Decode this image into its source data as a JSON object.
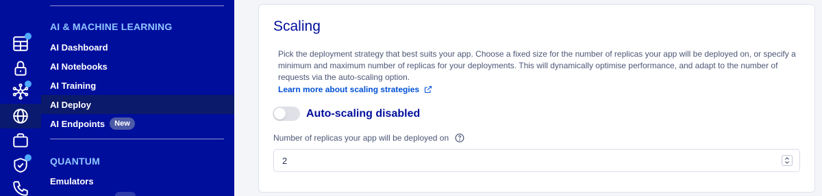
{
  "rail": {
    "icons": [
      "server-icon",
      "lock-icon",
      "network-icon",
      "globe-icon",
      "briefcase-icon",
      "shield-check-icon",
      "phone-icon"
    ],
    "accent": "#000e9c",
    "dot_color": "#4fa8ff"
  },
  "sidebar": {
    "ai_section": {
      "title": "AI & MACHINE LEARNING",
      "items": [
        {
          "label": "AI Dashboard"
        },
        {
          "label": "AI Notebooks"
        },
        {
          "label": "AI Training"
        },
        {
          "label": "AI Deploy"
        },
        {
          "label": "AI Endpoints",
          "badge": "New"
        }
      ]
    },
    "quantum_section": {
      "title": "QUANTUM",
      "items": [
        {
          "label": "Emulators"
        }
      ]
    }
  },
  "scaling": {
    "title": "Scaling",
    "description": "Pick the deployment strategy that best suits your app. Choose a fixed size for the number of replicas your app will be deployed on, or specify a minimum and maximum number of replicas for your deployments. This will dynamically optimise performance, and adapt to the number of requests via the auto-scaling option.",
    "learn_more": "Learn more about scaling strategies",
    "autoscaling_label": "Auto-scaling disabled",
    "autoscaling_enabled": false,
    "replicas_label": "Number of replicas your app will be deployed on",
    "replicas_value": "2"
  }
}
